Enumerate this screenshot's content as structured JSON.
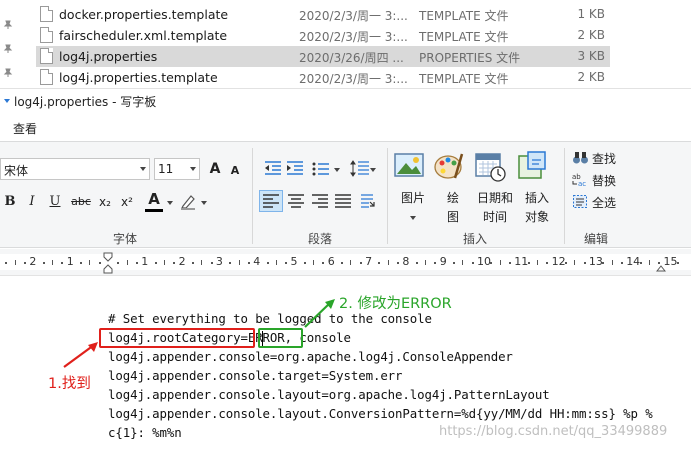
{
  "explorer": {
    "files": [
      {
        "name": "docker.properties.template",
        "date": "2020/2/3/周一 3:...",
        "type": "TEMPLATE 文件",
        "size": "1 KB",
        "selected": false
      },
      {
        "name": "fairscheduler.xml.template",
        "date": "2020/2/3/周一 3:...",
        "type": "TEMPLATE 文件",
        "size": "2 KB",
        "selected": false
      },
      {
        "name": "log4j.properties",
        "date": "2020/3/26/周四 ...",
        "type": "PROPERTIES 文件",
        "size": "3 KB",
        "selected": true
      },
      {
        "name": "log4j.properties.template",
        "date": "2020/2/3/周一 3:...",
        "type": "TEMPLATE 文件",
        "size": "2 KB",
        "selected": false
      }
    ]
  },
  "window": {
    "title": "log4j.properties - 写字板"
  },
  "ribbon": {
    "tab_view": "查看",
    "font": {
      "family": "宋体",
      "size": "11",
      "grow_label": "A",
      "shrink_label": "A",
      "bold": "B",
      "italic": "I",
      "underline": "U",
      "strike": "abc",
      "subscript": "x₂",
      "superscript": "x²",
      "color_label": "A",
      "group_label": "字体"
    },
    "paragraph": {
      "group_label": "段落"
    },
    "insert": {
      "picture": "图片",
      "paint": "绘\n图",
      "datetime": "日期和\n时间",
      "object": "插入\n对象",
      "group_label": "插入"
    },
    "edit": {
      "find": "查找",
      "replace": "替换",
      "select_all": "全选",
      "group_label": "编辑"
    },
    "accent_color": "#2b78d4"
  },
  "ruler": {
    "numbers": [
      "3",
      "2",
      "1",
      "1",
      "2",
      "3",
      "4",
      "5",
      "6",
      "7",
      "8",
      "9",
      "10",
      "11",
      "12",
      "13",
      "14",
      "15"
    ]
  },
  "document": {
    "lines": [
      "# Set everything to be logged to the console",
      "log4j.rootCategory=ERROR, console",
      "log4j.appender.console=org.apache.log4j.ConsoleAppender",
      "log4j.appender.console.target=System.err",
      "log4j.appender.console.layout=org.apache.log4j.PatternLayout",
      "log4j.appender.console.layout.ConversionPattern=%d{yy/MM/dd HH:mm:ss} %p %",
      "c{1}: %m%n"
    ]
  },
  "annotations": {
    "step1": "1.找到",
    "step2": "2. 修改为ERROR",
    "find_color": "#e0201b",
    "change_color": "#2aa52a"
  },
  "watermark": "https://blog.csdn.net/qq_33499889"
}
